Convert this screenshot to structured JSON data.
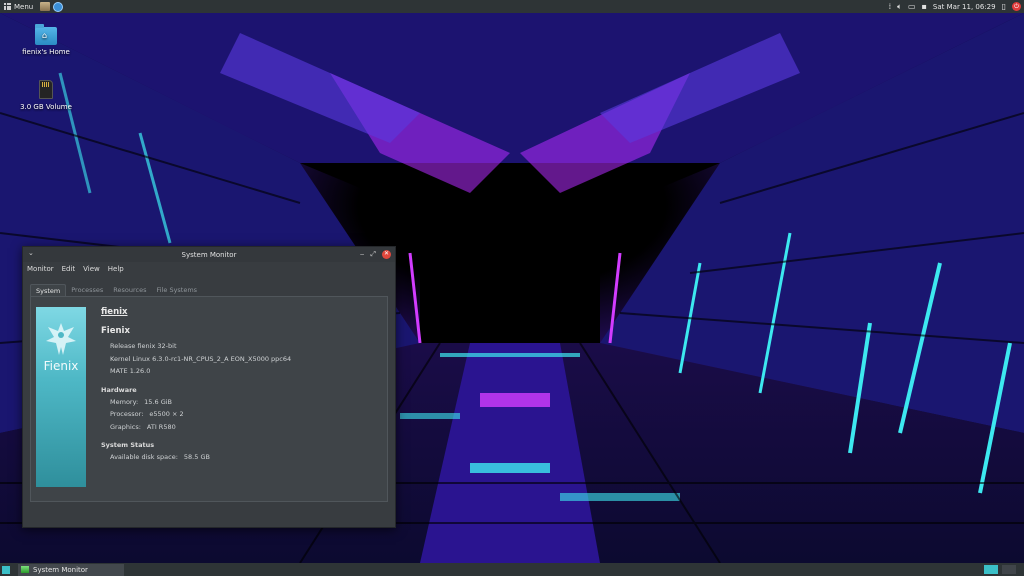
{
  "top_panel": {
    "menu_label": "Menu",
    "clock": "Sat Mar 11, 06:29",
    "icons": [
      "menu-grid-icon",
      "file-manager-icon",
      "browser-icon",
      "keyboard-icon",
      "volume-icon",
      "network-icon",
      "notification-icon",
      "power-icon"
    ]
  },
  "desktop": {
    "icons": [
      {
        "label": "fienix's Home",
        "icon": "home-folder-icon"
      },
      {
        "label": "3.0 GB Volume",
        "icon": "sd-card-icon"
      }
    ]
  },
  "window": {
    "title": "System Monitor",
    "menu": [
      "Monitor",
      "Edit",
      "View",
      "Help"
    ],
    "tabs": [
      "System",
      "Processes",
      "Resources",
      "File Systems"
    ],
    "active_tab": "System",
    "logo_text": "Fienix",
    "hostname": "fienix",
    "os_name": "Fienix",
    "release": "Release fienix 32-bit",
    "kernel": "Kernel Linux 6.3.0-rc1-NR_CPUS_2_A EON_X5000 ppc64",
    "mate": "MATE 1.26.0",
    "hardware_heading": "Hardware",
    "memory_label": "Memory:",
    "memory_value": "15.6 GiB",
    "processor_label": "Processor:",
    "processor_value": "e5500 × 2",
    "graphics_label": "Graphics:",
    "graphics_value": "ATI R580",
    "status_heading": "System Status",
    "disk_label": "Available disk space:",
    "disk_value": "58.5 GB"
  },
  "taskbar": {
    "task_label": "System Monitor"
  },
  "colors": {
    "panel": "#2e3436",
    "accent": "#3bc0c8",
    "close": "#e0473c"
  }
}
